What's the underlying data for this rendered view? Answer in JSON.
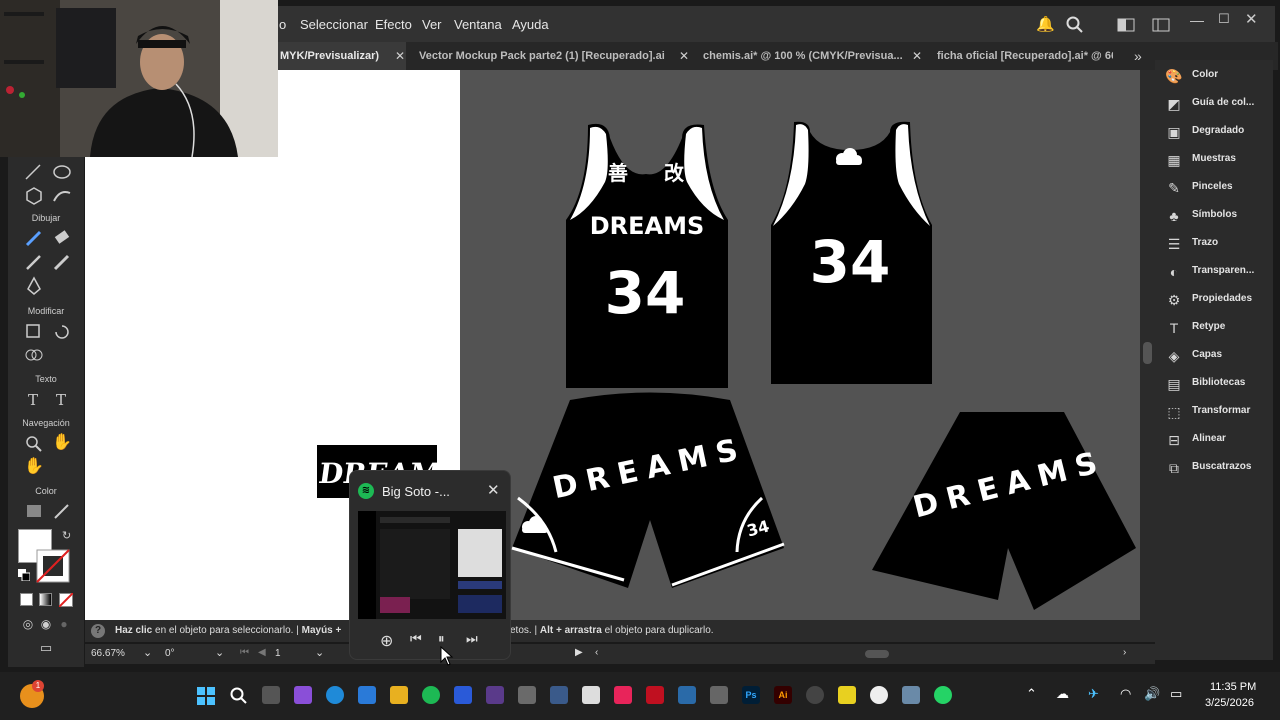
{
  "menu": {
    "items": [
      "o",
      "Seleccionar",
      "Efecto",
      "Ver",
      "Ventana",
      "Ayuda"
    ]
  },
  "tabs": [
    {
      "label": "MYK/Previsualizar)",
      "active": true
    },
    {
      "label": "Vector Mockup Pack parte2  (1) [Recuperado].ai",
      "active": false
    },
    {
      "label": "chemis.ai* @ 100 % (CMYK/Previsua...",
      "active": false
    },
    {
      "label": "ficha oficial [Recuperado].ai* @ 66",
      "active": false
    }
  ],
  "toolbar": {
    "sections": [
      "Dibujar",
      "Modificar",
      "Texto",
      "Navegación",
      "Color"
    ]
  },
  "panels": [
    {
      "label": "Color",
      "icon": "palette-icon"
    },
    {
      "label": "Guía de col...",
      "icon": "color-guide-icon"
    },
    {
      "label": "Degradado",
      "icon": "gradient-icon"
    },
    {
      "label": "Muestras",
      "icon": "swatches-icon"
    },
    {
      "label": "Pinceles",
      "icon": "brushes-icon"
    },
    {
      "label": "Símbolos",
      "icon": "symbols-icon"
    },
    {
      "label": "Trazo",
      "icon": "stroke-icon"
    },
    {
      "label": "Transparen...",
      "icon": "transparency-icon"
    },
    {
      "label": "Propiedades",
      "icon": "properties-icon"
    },
    {
      "label": "Retype",
      "icon": "retype-icon"
    },
    {
      "label": "Capas",
      "icon": "layers-icon"
    },
    {
      "label": "Bibliotecas",
      "icon": "libraries-icon"
    },
    {
      "label": "Transformar",
      "icon": "transform-icon"
    },
    {
      "label": "Alinear",
      "icon": "align-icon"
    },
    {
      "label": "Buscatrazos",
      "icon": "pathfinder-icon"
    }
  ],
  "status": {
    "left_bold": "Haz clic",
    "left_text": " en el objeto para seleccionarlo.  |  ",
    "left_bold2": "Mayús +",
    "right_text_pre": "etos.  |  ",
    "right_bold": "Alt + arrastra",
    "right_text": " el objeto para duplicarlo."
  },
  "bottom": {
    "zoom": "66.67%",
    "angle": "0°",
    "artboard": "1"
  },
  "jersey_front": {
    "kanji_left": "善",
    "kanji_right": "改",
    "team": "DREAMS",
    "number": "34"
  },
  "jersey_back": {
    "number": "34"
  },
  "shorts_front": {
    "text": "DREAMS",
    "number": "34"
  },
  "shorts_back": {
    "text": "DREAMS"
  },
  "thumb": {
    "text": "DREAMS"
  },
  "spotify": {
    "title": "Big Soto -..."
  },
  "clock": {
    "time": "11:35 PM",
    "date": "3/25/2026"
  },
  "colors": {
    "accent": "#1db954",
    "canvas": "#535353",
    "panel": "#2b2b2b"
  }
}
